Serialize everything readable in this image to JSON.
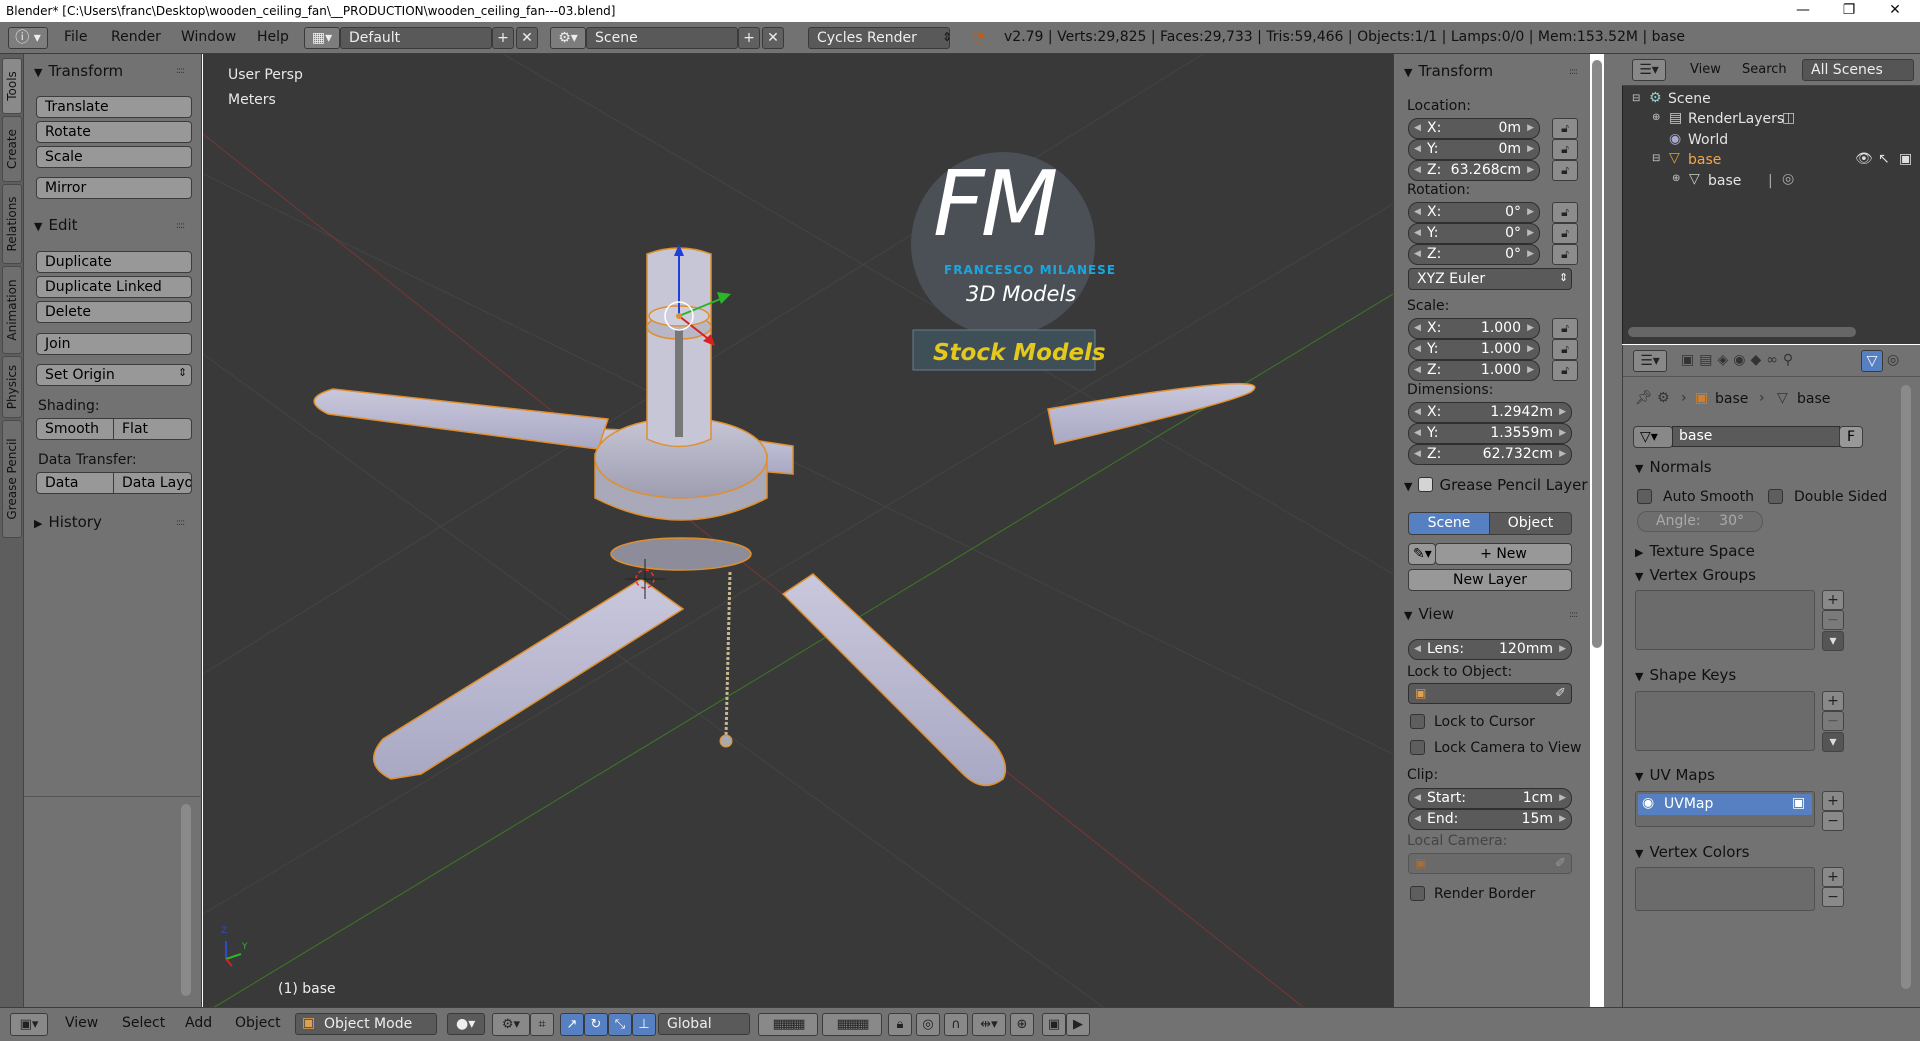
{
  "window": {
    "title": "Blender* [C:\\Users\\franc\\Desktop\\wooden_ceiling_fan\\__PRODUCTION\\wooden_ceiling_fan---03.blend]",
    "minimize": "—",
    "maximize": "❐",
    "close": "✕"
  },
  "infobar": {
    "menus": [
      "File",
      "Render",
      "Window",
      "Help"
    ],
    "layout": "Default",
    "scene": "Scene",
    "engine": "Cycles Render",
    "stats": "v2.79 | Verts:29,825 | Faces:29,733 | Tris:59,466 | Objects:1/1 | Lamps:0/0 | Mem:153.52M | base"
  },
  "tabs": [
    "Tools",
    "Create",
    "Relations",
    "Animation",
    "Physics",
    "Grease Pencil"
  ],
  "toolshelf": {
    "transform_title": "Transform",
    "translate": "Translate",
    "rotate": "Rotate",
    "scale": "Scale",
    "mirror": "Mirror",
    "edit_title": "Edit",
    "duplicate": "Duplicate",
    "duplicate_linked": "Duplicate Linked",
    "delete": "Delete",
    "join": "Join",
    "set_origin": "Set Origin",
    "shading_label": "Shading:",
    "smooth": "Smooth",
    "flat": "Flat",
    "data_transfer_label": "Data Transfer:",
    "data": "Data",
    "data_layo": "Data Layo",
    "history_title": "History"
  },
  "viewport": {
    "view_name": "User Persp",
    "units": "Meters",
    "object_label": "(1) base",
    "watermark_initials": "FM",
    "watermark_name": "FRANCESCO MILANESE",
    "watermark_sub": "3D Models",
    "watermark_banner": "Stock Models",
    "axis_z": "Z",
    "axis_y": "Y"
  },
  "npanel": {
    "transform_title": "Transform",
    "location_label": "Location:",
    "loc": [
      {
        "l": "X:",
        "v": "0m"
      },
      {
        "l": "Y:",
        "v": "0m"
      },
      {
        "l": "Z:",
        "v": "63.268cm"
      }
    ],
    "rotation_label": "Rotation:",
    "rot": [
      {
        "l": "X:",
        "v": "0°"
      },
      {
        "l": "Y:",
        "v": "0°"
      },
      {
        "l": "Z:",
        "v": "0°"
      }
    ],
    "rotation_mode": "XYZ Euler",
    "scale_label": "Scale:",
    "scl": [
      {
        "l": "X:",
        "v": "1.000"
      },
      {
        "l": "Y:",
        "v": "1.000"
      },
      {
        "l": "Z:",
        "v": "1.000"
      }
    ],
    "dimensions_label": "Dimensions:",
    "dim": [
      {
        "l": "X:",
        "v": "1.2942m"
      },
      {
        "l": "Y:",
        "v": "1.3559m"
      },
      {
        "l": "Z:",
        "v": "62.732cm"
      }
    ],
    "grease_title": "Grease Pencil Layer",
    "gp_scene": "Scene",
    "gp_object": "Object",
    "gp_new": "New",
    "gp_new_layer": "New Layer",
    "view_title": "View",
    "lens_label": "Lens:",
    "lens_value": "120mm",
    "lock_to_object": "Lock to Object:",
    "lock_to_cursor": "Lock to Cursor",
    "lock_camera": "Lock Camera to View",
    "clip_label": "Clip:",
    "clip_start_l": "Start:",
    "clip_start_v": "1cm",
    "clip_end_l": "End:",
    "clip_end_v": "15m",
    "local_camera": "Local Camera:",
    "render_border": "Render Border"
  },
  "outliner": {
    "view": "View",
    "search": "Search",
    "filter": "All Scenes",
    "items": [
      "Scene",
      "RenderLayers",
      "World",
      "base",
      "base"
    ]
  },
  "properties": {
    "crumb_obj": "base",
    "crumb_mesh": "base",
    "mesh_name": "base",
    "fake_user": "F",
    "normals": "Normals",
    "auto_smooth": "Auto Smooth",
    "double_sided": "Double Sided",
    "angle": "Angle:",
    "angle_value": "30°",
    "texture_space": "Texture Space",
    "vertex_groups": "Vertex Groups",
    "shape_keys": "Shape Keys",
    "uv_maps": "UV Maps",
    "uv_item": "UVMap",
    "vertex_colors": "Vertex Colors"
  },
  "vpheader": {
    "view": "View",
    "select": "Select",
    "add": "Add",
    "object": "Object",
    "mode": "Object Mode",
    "orientation": "Global"
  },
  "colors": {
    "ui_gray": "#727272",
    "viewport_bg": "#393939",
    "selected_blue": "#5680c2",
    "watermark_blue": "#1aa7e0",
    "watermark_yellow": "#e5c81c",
    "selection_outline": "#f0a030"
  }
}
